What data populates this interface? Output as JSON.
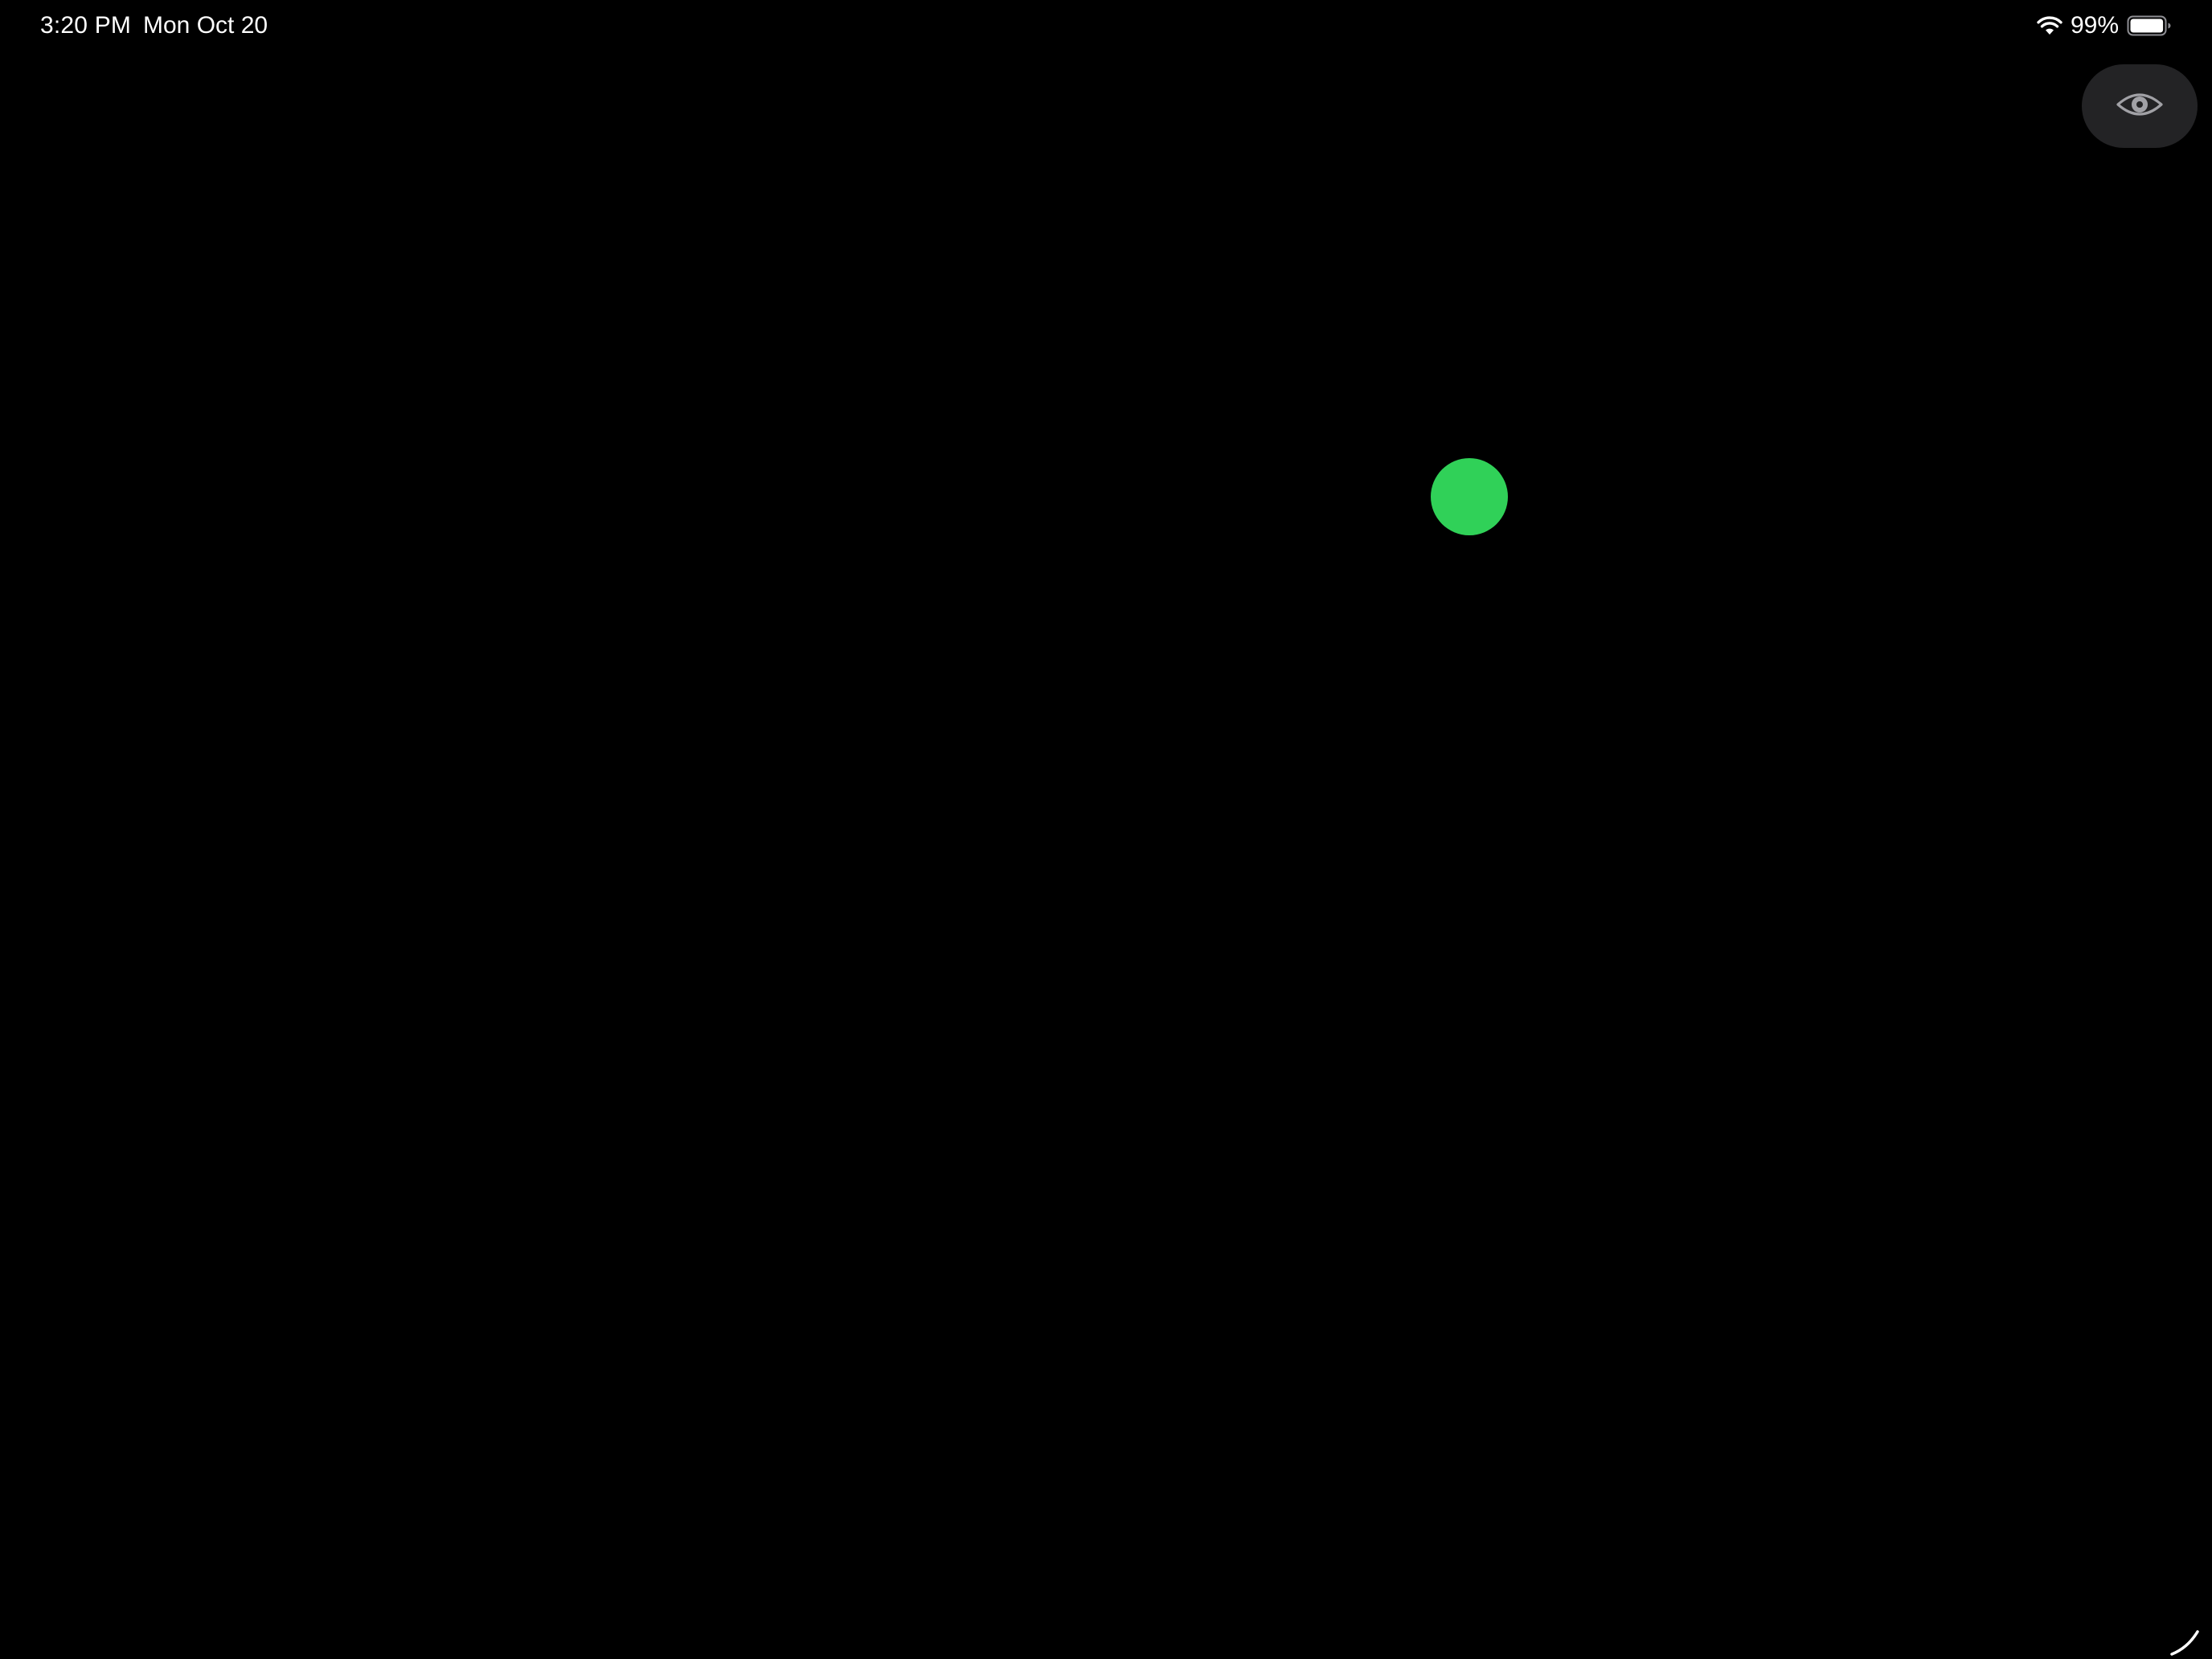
{
  "status_bar": {
    "time": "3:20 PM",
    "date": "Mon Oct 20",
    "battery_percent": "99%",
    "battery_level": 0.99,
    "wifi_icon": "wifi-icon",
    "battery_icon": "battery-icon"
  },
  "eye_button": {
    "icon": "eye-icon"
  },
  "canvas": {
    "background_color": "#000000",
    "dot_color": "#30D158"
  },
  "corner": {
    "icon": "corner-resize-icon"
  }
}
